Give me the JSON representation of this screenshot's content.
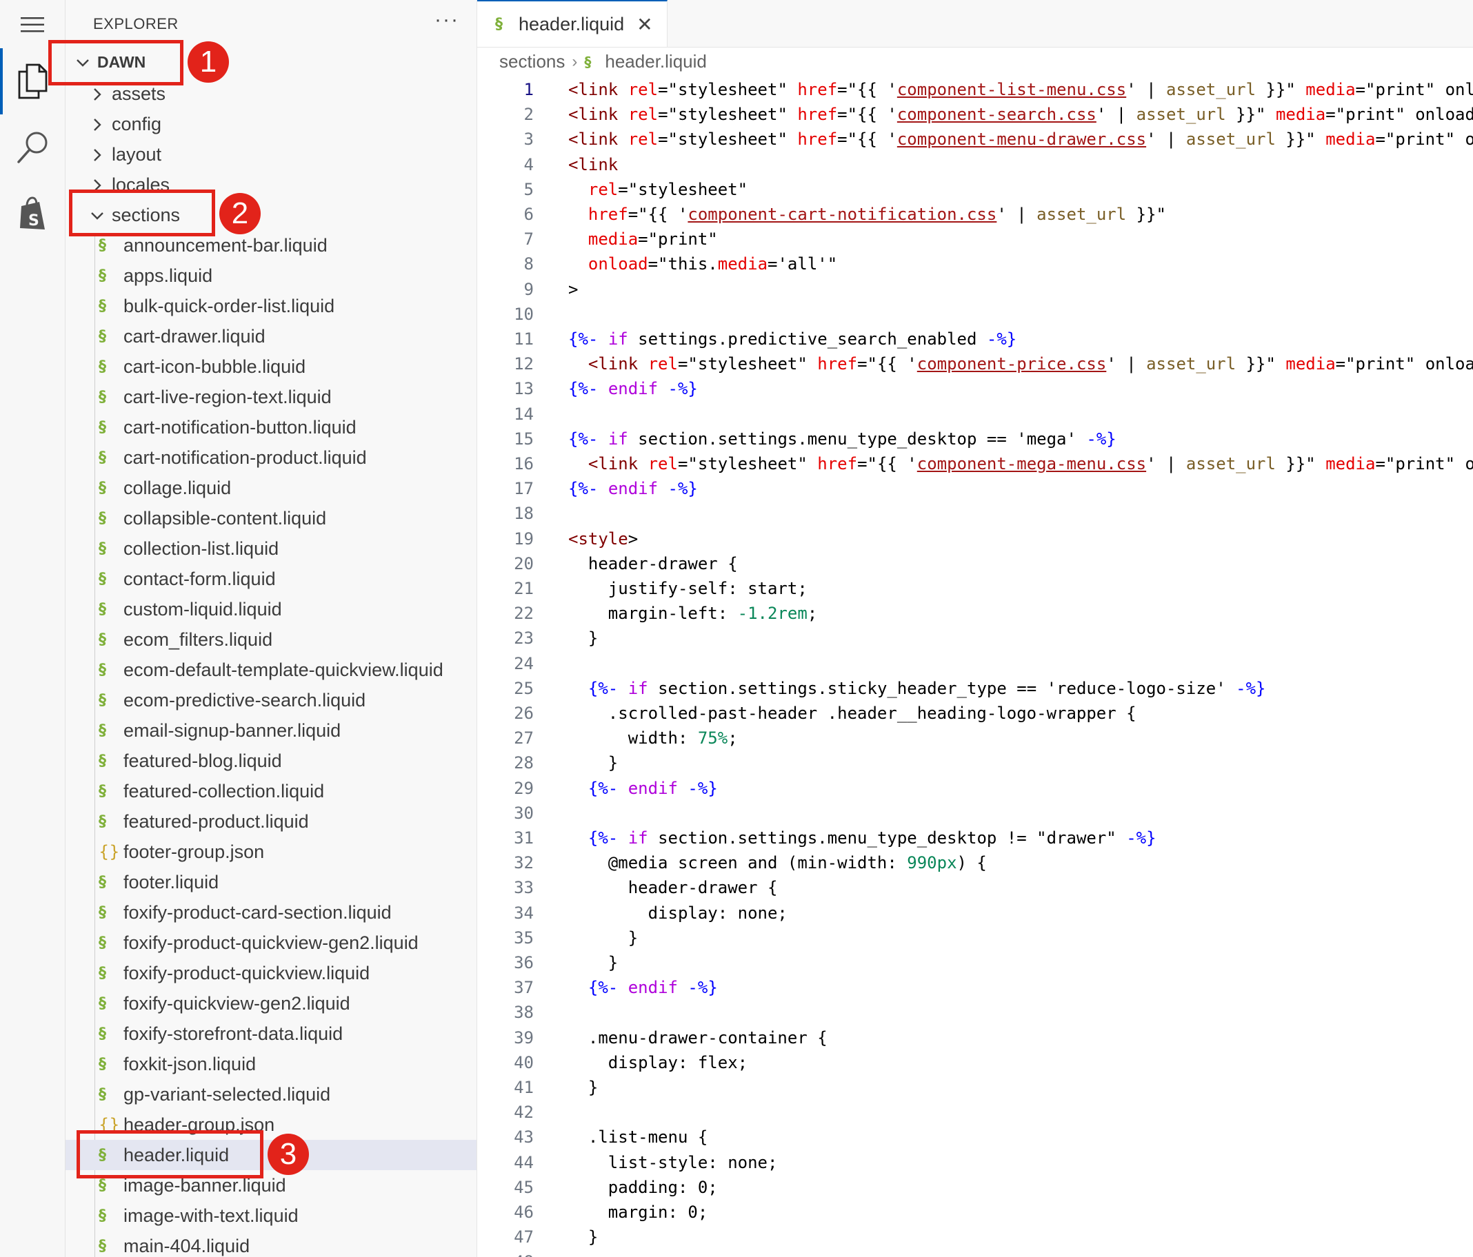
{
  "activity_bar": {
    "icons": [
      "menu-icon",
      "files-icon",
      "search-icon",
      "shopify-icon"
    ]
  },
  "explorer": {
    "title": "EXPLORER",
    "more": "···",
    "root": "DAWN",
    "folders": [
      "assets",
      "config",
      "layout",
      "locales"
    ],
    "open_folder": "sections",
    "files": [
      {
        "name": "announcement-bar.liquid",
        "icon": "liquid"
      },
      {
        "name": "apps.liquid",
        "icon": "liquid"
      },
      {
        "name": "bulk-quick-order-list.liquid",
        "icon": "liquid"
      },
      {
        "name": "cart-drawer.liquid",
        "icon": "liquid"
      },
      {
        "name": "cart-icon-bubble.liquid",
        "icon": "liquid"
      },
      {
        "name": "cart-live-region-text.liquid",
        "icon": "liquid"
      },
      {
        "name": "cart-notification-button.liquid",
        "icon": "liquid"
      },
      {
        "name": "cart-notification-product.liquid",
        "icon": "liquid"
      },
      {
        "name": "collage.liquid",
        "icon": "liquid"
      },
      {
        "name": "collapsible-content.liquid",
        "icon": "liquid"
      },
      {
        "name": "collection-list.liquid",
        "icon": "liquid"
      },
      {
        "name": "contact-form.liquid",
        "icon": "liquid"
      },
      {
        "name": "custom-liquid.liquid",
        "icon": "liquid"
      },
      {
        "name": "ecom_filters.liquid",
        "icon": "liquid"
      },
      {
        "name": "ecom-default-template-quickview.liquid",
        "icon": "liquid"
      },
      {
        "name": "ecom-predictive-search.liquid",
        "icon": "liquid"
      },
      {
        "name": "email-signup-banner.liquid",
        "icon": "liquid"
      },
      {
        "name": "featured-blog.liquid",
        "icon": "liquid"
      },
      {
        "name": "featured-collection.liquid",
        "icon": "liquid"
      },
      {
        "name": "featured-product.liquid",
        "icon": "liquid"
      },
      {
        "name": "footer-group.json",
        "icon": "json"
      },
      {
        "name": "footer.liquid",
        "icon": "liquid"
      },
      {
        "name": "foxify-product-card-section.liquid",
        "icon": "liquid"
      },
      {
        "name": "foxify-product-quickview-gen2.liquid",
        "icon": "liquid"
      },
      {
        "name": "foxify-product-quickview.liquid",
        "icon": "liquid"
      },
      {
        "name": "foxify-quickview-gen2.liquid",
        "icon": "liquid"
      },
      {
        "name": "foxify-storefront-data.liquid",
        "icon": "liquid"
      },
      {
        "name": "foxkit-json.liquid",
        "icon": "liquid"
      },
      {
        "name": "gp-variant-selected.liquid",
        "icon": "liquid"
      },
      {
        "name": "header-group.json",
        "icon": "json"
      },
      {
        "name": "header.liquid",
        "icon": "liquid",
        "selected": true
      },
      {
        "name": "image-banner.liquid",
        "icon": "liquid"
      },
      {
        "name": "image-with-text.liquid",
        "icon": "liquid"
      },
      {
        "name": "main-404.liquid",
        "icon": "liquid"
      }
    ]
  },
  "callouts": [
    "1",
    "2",
    "3"
  ],
  "colors": {
    "callout": "#e2231a",
    "accent": "#005fb8",
    "liquid_icon": "#7fb03a"
  },
  "editor": {
    "tab": {
      "label": "header.liquid",
      "close": "✕"
    },
    "breadcrumb": {
      "folder": "sections",
      "file": "header.liquid"
    },
    "active_line": 1,
    "lines": [
      "<link rel=\"stylesheet\" href=\"{{ 'component-list-menu.css' | asset_url }}\" media=\"print\" onl",
      "<link rel=\"stylesheet\" href=\"{{ 'component-search.css' | asset_url }}\" media=\"print\" onload",
      "<link rel=\"stylesheet\" href=\"{{ 'component-menu-drawer.css' | asset_url }}\" media=\"print\" o",
      "<link",
      "  rel=\"stylesheet\"",
      "  href=\"{{ 'component-cart-notification.css' | asset_url }}\"",
      "  media=\"print\"",
      "  onload=\"this.media='all'\"",
      ">",
      "",
      "{%- if settings.predictive_search_enabled -%}",
      "  <link rel=\"stylesheet\" href=\"{{ 'component-price.css' | asset_url }}\" media=\"print\" onloa",
      "{%- endif -%}",
      "",
      "{%- if section.settings.menu_type_desktop == 'mega' -%}",
      "  <link rel=\"stylesheet\" href=\"{{ 'component-mega-menu.css' | asset_url }}\" media=\"print\" o",
      "{%- endif -%}",
      "",
      "<style>",
      "  header-drawer {",
      "    justify-self: start;",
      "    margin-left: -1.2rem;",
      "  }",
      "",
      "  {%- if section.settings.sticky_header_type == 'reduce-logo-size' -%}",
      "    .scrolled-past-header .header__heading-logo-wrapper {",
      "      width: 75%;",
      "    }",
      "  {%- endif -%}",
      "",
      "  {%- if section.settings.menu_type_desktop != \"drawer\" -%}",
      "    @media screen and (min-width: 990px) {",
      "      header-drawer {",
      "        display: none;",
      "      }",
      "    }",
      "  {%- endif -%}",
      "",
      "  .menu-drawer-container {",
      "    display: flex;",
      "  }",
      "",
      "  .list-menu {",
      "    list-style: none;",
      "    padding: 0;",
      "    margin: 0;",
      "  }",
      ""
    ]
  }
}
